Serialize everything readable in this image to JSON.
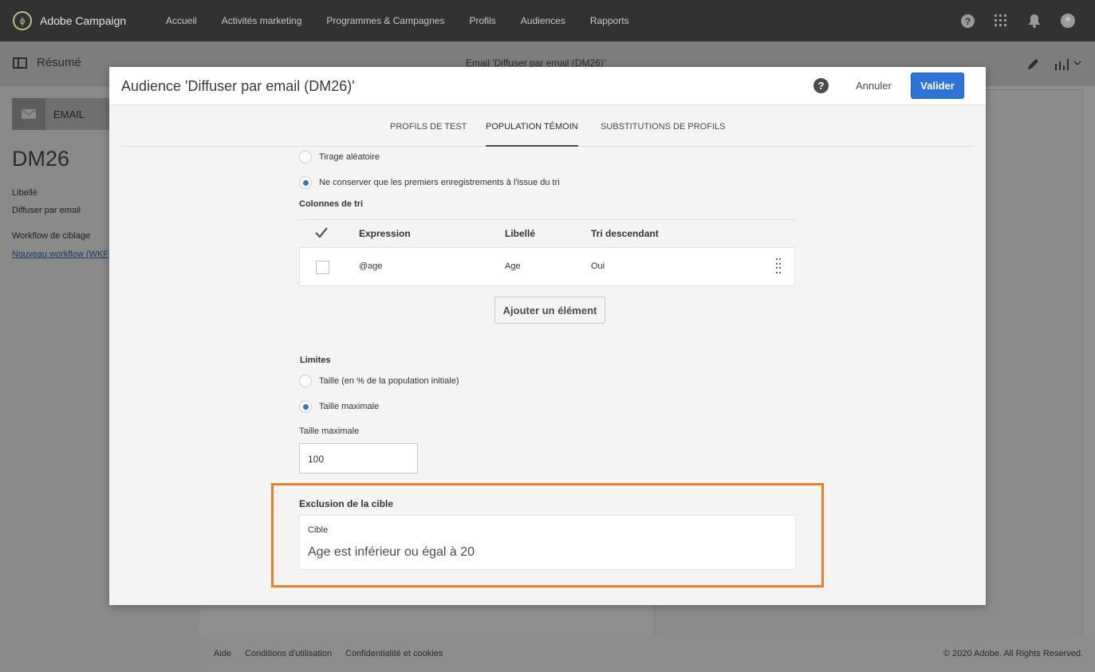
{
  "app": {
    "brand": "Adobe Campaign",
    "nav": [
      "Accueil",
      "Activités marketing",
      "Programmes & Campagnes",
      "Profils",
      "Audiences",
      "Rapports"
    ],
    "icons": [
      "help-icon",
      "apps-grid-icon",
      "bell-icon",
      "user-avatar-icon"
    ]
  },
  "background": {
    "resume": "Résumé",
    "center_title": "Email 'Diffuser par email (DM26)'",
    "channel": "EMAIL",
    "name": "DM26",
    "libelle_label": "Libellé",
    "libelle_value": "Diffuser par email",
    "workflow_label": "Workflow de ciblage",
    "workflow_link": "Nouveau workflow (WKF",
    "footer": {
      "aide": "Aide",
      "conditions": "Conditions d'utilisation",
      "privacy": "Confidentialité et cookies",
      "copyright": "© 2020 Adobe. All Rights Reserved."
    }
  },
  "modal": {
    "title": "Audience 'Diffuser par email (DM26)'",
    "cancel": "Annuler",
    "validate": "Valider",
    "tabs": [
      "PROFILS DE TEST",
      "POPULATION TÉMOIN",
      "SUBSTITUTIONS DE PROFILS"
    ],
    "active_tab": "POPULATION TÉMOIN",
    "radio_random": "Tirage aléatoire",
    "radio_keep_first": "Ne conserver que les premiers enregistrements à l'issue du tri",
    "sort_columns_label": "Colonnes de tri",
    "grid": {
      "headers": [
        "Expression",
        "Libellé",
        "Tri descendant"
      ],
      "rows": [
        {
          "expression": "@age",
          "libelle": "Age",
          "tri": "Oui"
        }
      ]
    },
    "add_button": "Ajouter un élément",
    "limits_label": "Limites",
    "radio_size_percent": "Taille (en % de la population initiale)",
    "radio_size_max": "Taille maximale",
    "max_size_label": "Taille maximale",
    "max_size_value": "100",
    "exclusion_title": "Exclusion de la cible",
    "exclusion_caption": "Cible",
    "exclusion_value": "Age est inférieur ou égal à 20"
  },
  "colors": {
    "accent": "#2d74d6",
    "highlight": "#f07e26",
    "topbar": "#323232"
  }
}
